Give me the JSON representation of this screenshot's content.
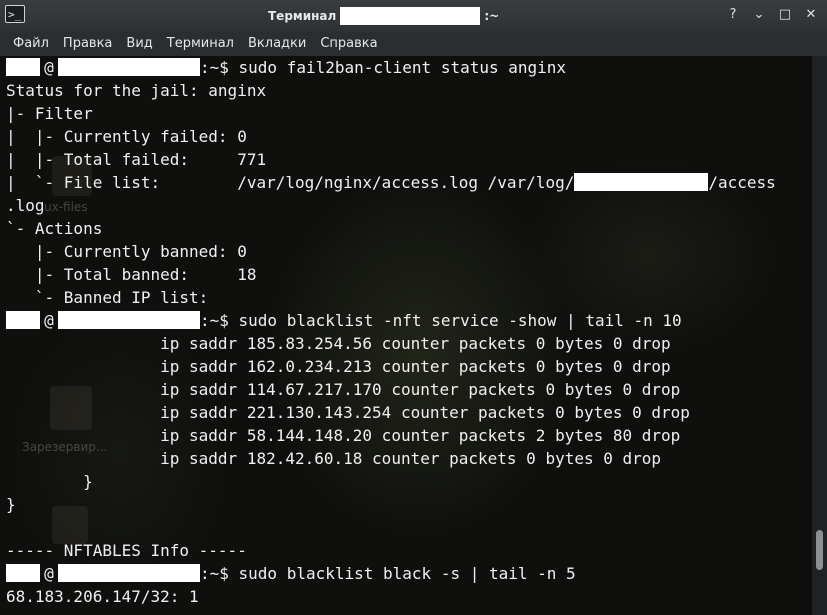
{
  "window": {
    "title_prefix": "Терминал",
    "title_suffix": ":~"
  },
  "controls": {
    "help": "?",
    "minimize": "⌄",
    "maximize": "□",
    "close": "✕"
  },
  "menu": [
    "Файл",
    "Правка",
    "Вид",
    "Терминал",
    "Вкладки",
    "Справка"
  ],
  "desktop_labels": {
    "files": "ux-files",
    "reserved": "Зарезервир..."
  },
  "terminal": {
    "prompt_path": ":~$ ",
    "lines": [
      {
        "type": "prompt",
        "command": "sudo fail2ban-client status anginx"
      },
      {
        "type": "text",
        "text": "Status for the jail: anginx"
      },
      {
        "type": "text",
        "text": "|- Filter"
      },
      {
        "type": "text",
        "text": "|  |- Currently failed: 0"
      },
      {
        "type": "text",
        "text": "|  |- Total failed:     771"
      },
      {
        "type": "filelist",
        "before": "|  `- File list:        /var/log/nginx/access.log /var/log/",
        "after": "/access"
      },
      {
        "type": "text",
        "text": ".log"
      },
      {
        "type": "text",
        "text": "`- Actions"
      },
      {
        "type": "text",
        "text": "   |- Currently banned: 0"
      },
      {
        "type": "text",
        "text": "   |- Total banned:     18"
      },
      {
        "type": "text",
        "text": "   `- Banned IP list:"
      },
      {
        "type": "prompt",
        "command": "sudo blacklist -nft service -show | tail -n 10"
      },
      {
        "type": "text",
        "text": "                ip saddr 185.83.254.56 counter packets 0 bytes 0 drop"
      },
      {
        "type": "text",
        "text": "                ip saddr 162.0.234.213 counter packets 0 bytes 0 drop"
      },
      {
        "type": "text",
        "text": "                ip saddr 114.67.217.170 counter packets 0 bytes 0 drop"
      },
      {
        "type": "text",
        "text": "                ip saddr 221.130.143.254 counter packets 0 bytes 0 drop"
      },
      {
        "type": "text",
        "text": "                ip saddr 58.144.148.20 counter packets 2 bytes 80 drop"
      },
      {
        "type": "text",
        "text": "                ip saddr 182.42.60.18 counter packets 0 bytes 0 drop"
      },
      {
        "type": "text",
        "text": "        }"
      },
      {
        "type": "text",
        "text": "}"
      },
      {
        "type": "text",
        "text": ""
      },
      {
        "type": "text",
        "text": "----- NFTABLES Info -----"
      },
      {
        "type": "prompt",
        "command": "sudo blacklist black -s | tail -n 5"
      },
      {
        "type": "text",
        "text": "68.183.206.147/32: 1"
      }
    ]
  }
}
